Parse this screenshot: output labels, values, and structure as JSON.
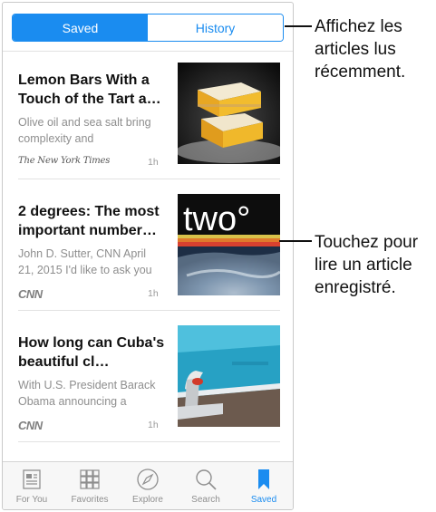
{
  "segmented": {
    "saved": "Saved",
    "history": "History"
  },
  "articles": [
    {
      "title": "Lemon Bars With a Touch of the Tart a…",
      "snippet": "Olive oil and sea salt bring complexity and",
      "source": "The New York Times",
      "time": "1h",
      "image": "lemon-bars-photo"
    },
    {
      "title": "2 degrees: The most important number…",
      "snippet": "John D. Sutter, CNN April 21, 2015 I'd like to ask you",
      "source": "CNN",
      "time": "1h",
      "image": "two-degrees-photo",
      "image_text": "two°"
    },
    {
      "title": "How long can Cuba's beautiful cl…",
      "snippet": "With U.S. President Barack Obama announcing a",
      "source": "CNN",
      "time": "1h",
      "image": "classic-car-photo"
    }
  ],
  "tabbar": [
    {
      "label": "For You",
      "icon": "newspaper-icon"
    },
    {
      "label": "Favorites",
      "icon": "grid-icon"
    },
    {
      "label": "Explore",
      "icon": "compass-icon"
    },
    {
      "label": "Search",
      "icon": "search-icon"
    },
    {
      "label": "Saved",
      "icon": "bookmark-icon",
      "active": true
    }
  ],
  "callouts": {
    "history": "Affichez les articles lus récemment.",
    "saved_article": "Touchez pour lire un article enregistré."
  },
  "colors": {
    "accent": "#1a8cf0",
    "inactive": "#8f8f8f"
  }
}
